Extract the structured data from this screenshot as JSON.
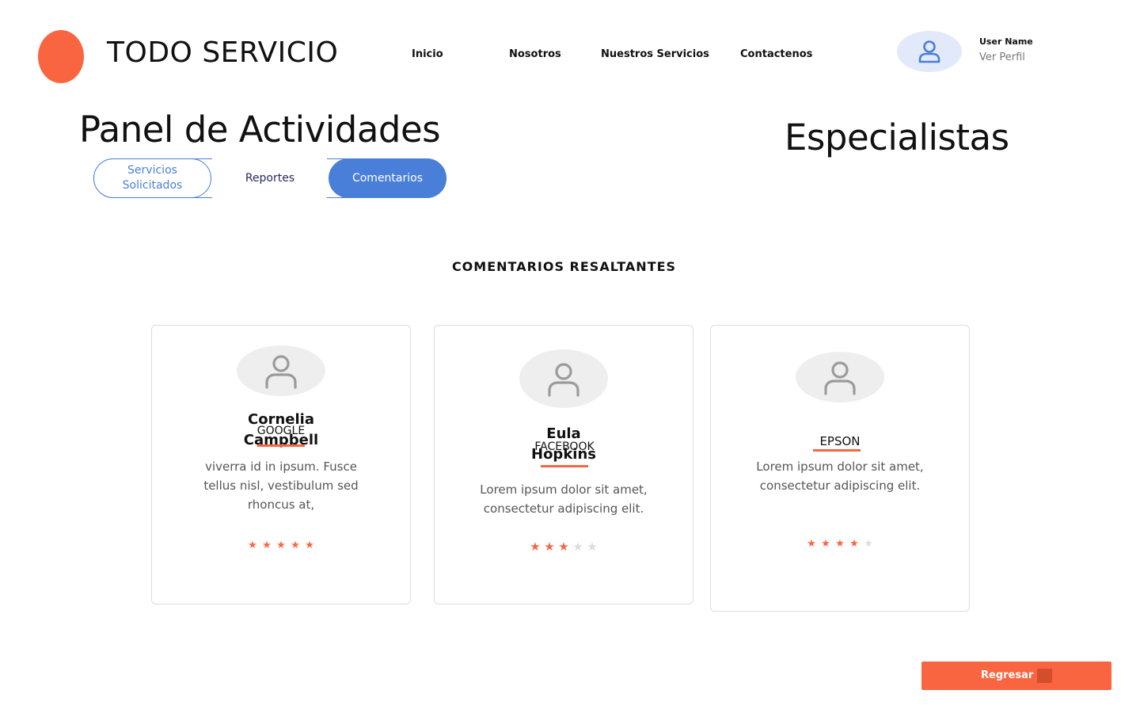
{
  "brand": {
    "name": "TODO SERVICIO",
    "logo_color": "#fa6541"
  },
  "nav": {
    "items": [
      {
        "label": "Inicio"
      },
      {
        "label": "Nosotros"
      },
      {
        "label": "Nuestros Servicios"
      },
      {
        "label": "Contactenos"
      }
    ]
  },
  "user": {
    "name": "User Name",
    "profile_link": "Ver Perfil",
    "icon": "user-icon"
  },
  "page": {
    "title": "Panel de Actividades",
    "side_title": "Especialistas"
  },
  "tabs": [
    {
      "label": "Servicios Solicitados",
      "state": "outlined"
    },
    {
      "label": "Reportes",
      "state": "default"
    },
    {
      "label": "Comentarios",
      "state": "active"
    }
  ],
  "section": {
    "heading": "COMENTARIOS RESALTANTES"
  },
  "cards": [
    {
      "name": "Cornelia Campbell",
      "company": "GOOGLE",
      "comment": "viverra id in ipsum. Fusce tellus nisl, vestibulum sed rhoncus at,",
      "rating": 5,
      "max_rating": 5
    },
    {
      "name": "Eula Hopkins",
      "company": "FACEBOOK",
      "comment": "Lorem ipsum dolor sit amet, consectetur adipiscing elit.",
      "rating": 3,
      "max_rating": 5
    },
    {
      "name": "",
      "company": "EPSON",
      "comment": "Lorem ipsum dolor sit amet, consectetur adipiscing elit.",
      "rating": 4,
      "max_rating": 5
    }
  ],
  "back_button": {
    "label": "Regresar"
  },
  "colors": {
    "accent": "#fa6541",
    "primary_blue": "#4a7fd9",
    "star_filled": "#fa6541",
    "star_empty": "#dddddd"
  }
}
